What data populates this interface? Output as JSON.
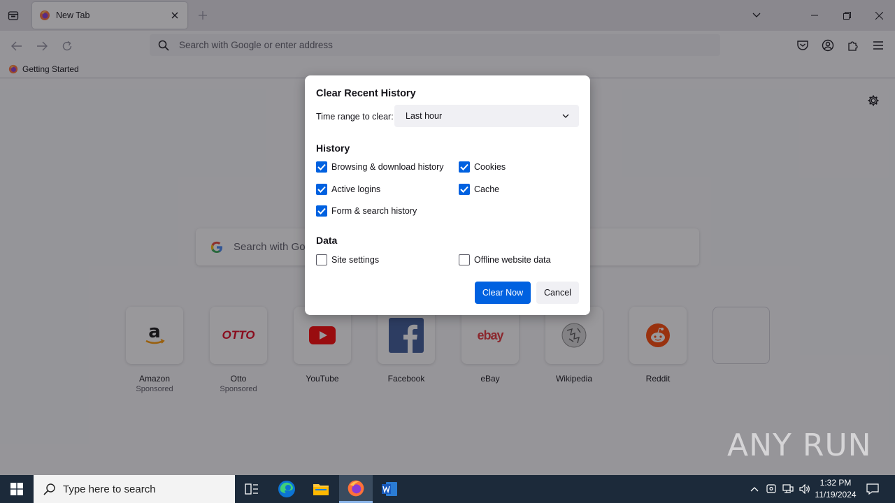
{
  "browser": {
    "tab": {
      "title": "New Tab"
    },
    "url_placeholder": "Search with Google or enter address",
    "bookmarks": [
      {
        "label": "Getting Started"
      }
    ]
  },
  "newtab": {
    "search_placeholder": "Search with Google or enter address",
    "tiles": [
      {
        "label": "Amazon",
        "sponsored": "Sponsored"
      },
      {
        "label": "Otto",
        "sponsored": "Sponsored"
      },
      {
        "label": "YouTube"
      },
      {
        "label": "Facebook"
      },
      {
        "label": "eBay"
      },
      {
        "label": "Wikipedia"
      },
      {
        "label": "Reddit"
      }
    ],
    "otto_logo_text": "OTTO",
    "ebay_logo_text": "ebay"
  },
  "dialog": {
    "title": "Clear Recent History",
    "time_range_label": "Time range to clear:",
    "time_range_value": "Last hour",
    "history_heading": "History",
    "history_items": [
      {
        "label": "Browsing & download history",
        "checked": true
      },
      {
        "label": "Cookies",
        "checked": true
      },
      {
        "label": "Active logins",
        "checked": true
      },
      {
        "label": "Cache",
        "checked": true
      },
      {
        "label": "Form & search history",
        "checked": true
      }
    ],
    "data_heading": "Data",
    "data_items": [
      {
        "label": "Site settings",
        "checked": false
      },
      {
        "label": "Offline website data",
        "checked": false
      }
    ],
    "clear_button": "Clear Now",
    "cancel_button": "Cancel"
  },
  "watermark": "ANY RUN",
  "taskbar": {
    "search_placeholder": "Type here to search",
    "time": "1:32 PM",
    "date": "11/19/2024"
  },
  "colors": {
    "accent": "#0061e0",
    "taskbar": "#1c2a3a"
  }
}
